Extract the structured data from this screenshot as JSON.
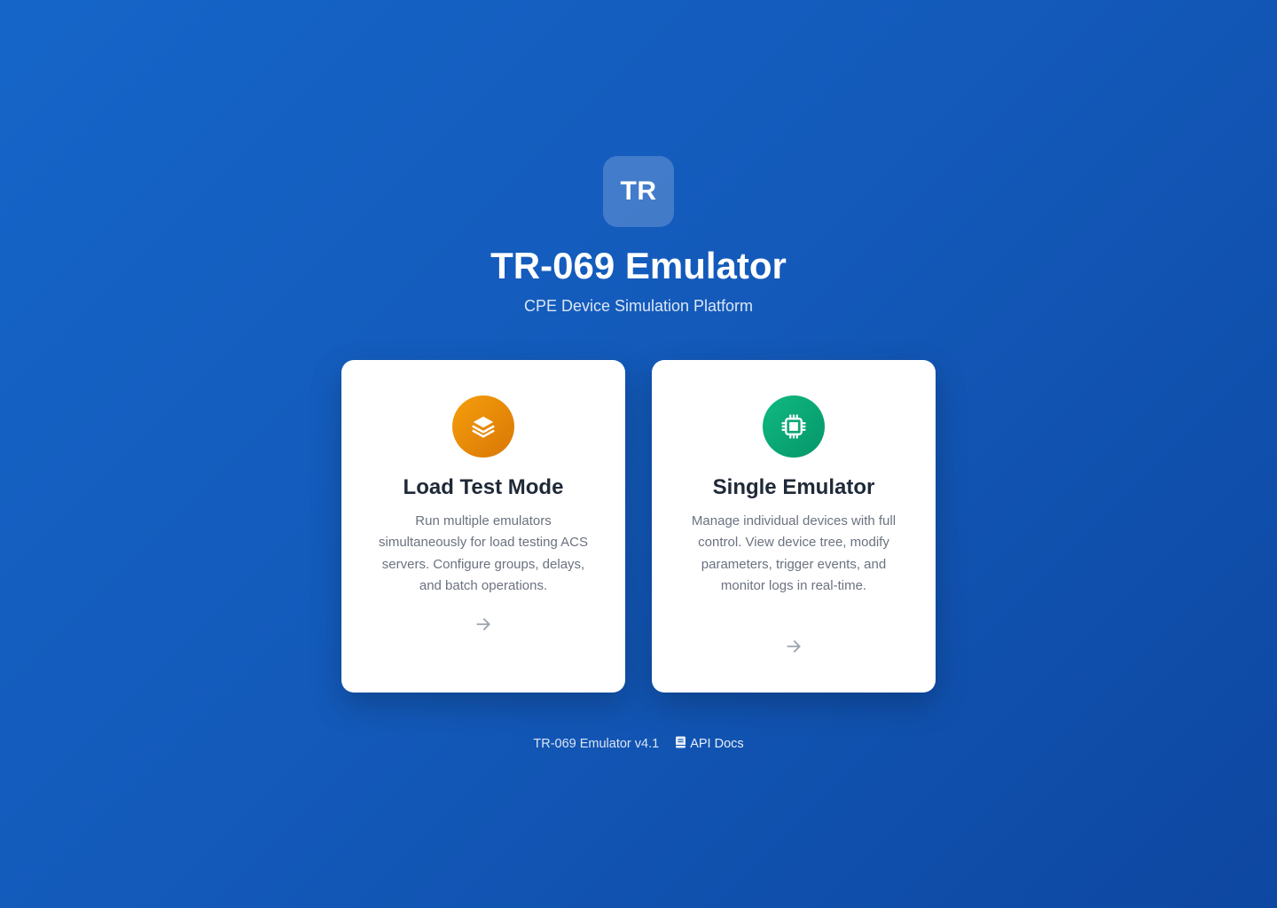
{
  "header": {
    "logo_text": "TR",
    "title": "TR-069 Emulator",
    "subtitle": "CPE Device Simulation Platform"
  },
  "cards": [
    {
      "title": "Load Test Mode",
      "description": "Run multiple emulators simultaneously for load testing ACS servers. Configure groups, delays, and batch operations.",
      "icon": "layers-icon",
      "icon_color": "#f59e0b",
      "arrow": "arrow-right-icon"
    },
    {
      "title": "Single Emulator",
      "description": "Manage individual devices with full control. View device tree, modify parameters, trigger events, and monitor logs in real-time.",
      "icon": "chip-icon",
      "icon_color": "#10b981",
      "arrow": "arrow-right-icon"
    }
  ],
  "footer": {
    "version": "TR-069 Emulator v4.1",
    "api_docs_label": "API Docs",
    "api_docs_icon": "book-icon"
  },
  "colors": {
    "background": "#1565c8",
    "card_background": "#ffffff",
    "title_text": "#1f2937",
    "description_text": "#6b7280"
  }
}
